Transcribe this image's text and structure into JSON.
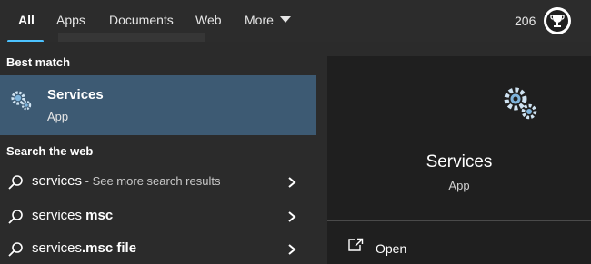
{
  "tabs": [
    {
      "label": "All",
      "active": true
    },
    {
      "label": "Apps"
    },
    {
      "label": "Documents"
    },
    {
      "label": "Web"
    },
    {
      "label": "More"
    }
  ],
  "header": {
    "points": "206",
    "avatar_icon": "trophy-icon"
  },
  "best_match": {
    "heading": "Best match",
    "title": "Services",
    "subtitle": "App",
    "icon": "gear-icon"
  },
  "web": {
    "heading": "Search the web",
    "items": [
      {
        "query": "services",
        "hint": " - See more search results",
        "suffix": ""
      },
      {
        "query": "services",
        "hint": "",
        "suffix": " msc"
      },
      {
        "query": "services",
        "hint": "",
        "suffix": ".msc file"
      }
    ]
  },
  "preview": {
    "title": "Services",
    "subtitle": "App",
    "actions": [
      {
        "label": "Open",
        "icon": "open-external-icon"
      }
    ]
  },
  "colors": {
    "accent": "#4cc2ff",
    "selected": "#3d5a73",
    "background": "#2b2b2b",
    "preview_bg": "#1f1f1f"
  }
}
